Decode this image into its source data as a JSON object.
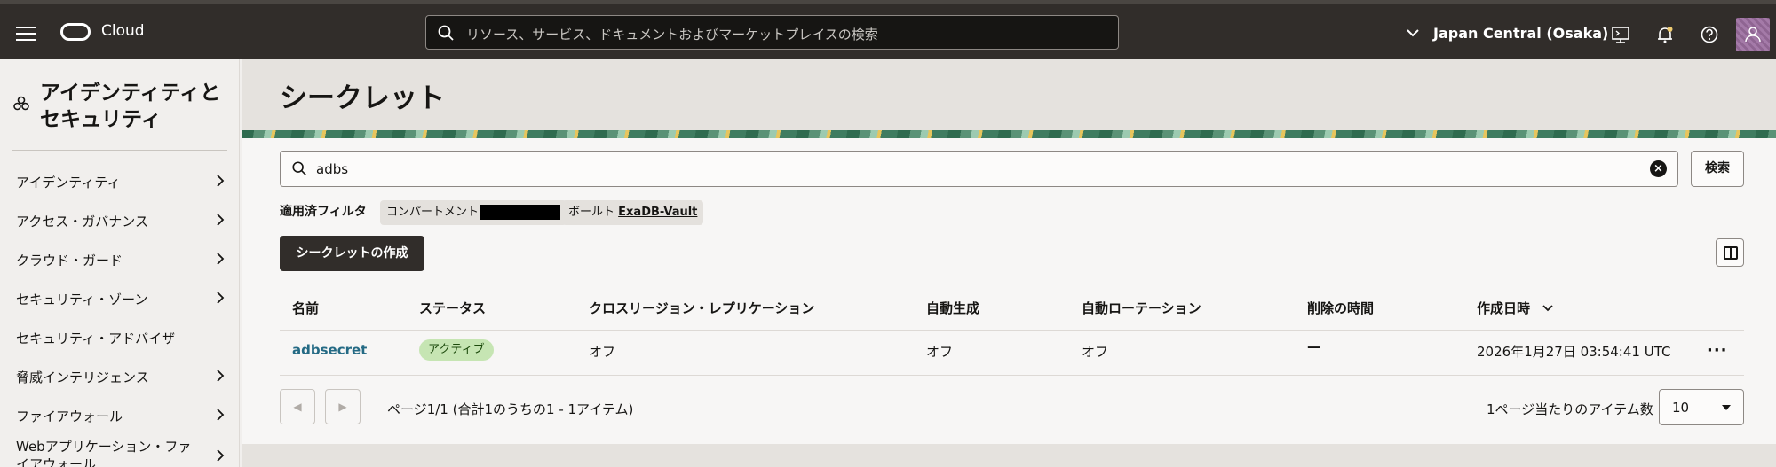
{
  "header": {
    "brand": "Cloud",
    "search_placeholder": "リソース、サービス、ドキュメントおよびマーケットプレイスの検索",
    "region": "Japan Central (Osaka)"
  },
  "sidebar": {
    "title": "アイデンティティとセキュリティ",
    "items": [
      {
        "label": "アイデンティティ"
      },
      {
        "label": "アクセス・ガバナンス"
      },
      {
        "label": "クラウド・ガード"
      },
      {
        "label": "セキュリティ・ゾーン"
      },
      {
        "label": "セキュリティ・アドバイザ"
      },
      {
        "label": "脅威インテリジェンス"
      },
      {
        "label": "ファイアウォール"
      },
      {
        "label": "Webアプリケーション・ファイアウォール"
      }
    ]
  },
  "page": {
    "title": "シークレット",
    "search_value": "adbs",
    "search_button": "検索",
    "filters_label": "適用済フィルタ",
    "filter_compartment": "コンパートメント",
    "filter_vault_label": "ボールト",
    "filter_vault_value": "ExaDB-Vault",
    "create_button": "シークレットの作成"
  },
  "table": {
    "columns": [
      "名前",
      "ステータス",
      "クロスリージョン・レプリケーション",
      "自動生成",
      "自動ローテーション",
      "削除の時間",
      "作成日時"
    ],
    "rows": [
      {
        "name": "adbsecret",
        "status": "アクティブ",
        "replication": "オフ",
        "auto_generation": "オフ",
        "auto_rotation": "オフ",
        "deletion_time": "—",
        "created": "2026年1月27日 03:54:41 UTC"
      }
    ]
  },
  "pagination": {
    "summary": "ページ1/1 (合計1のうちの1 - 1アイテム)",
    "per_page_label": "1ページ当たりのアイテム数",
    "per_page_value": "10"
  },
  "colors": {
    "header_bg": "#312d2a",
    "link": "#246a84",
    "active_badge": "#c6e5b3"
  }
}
